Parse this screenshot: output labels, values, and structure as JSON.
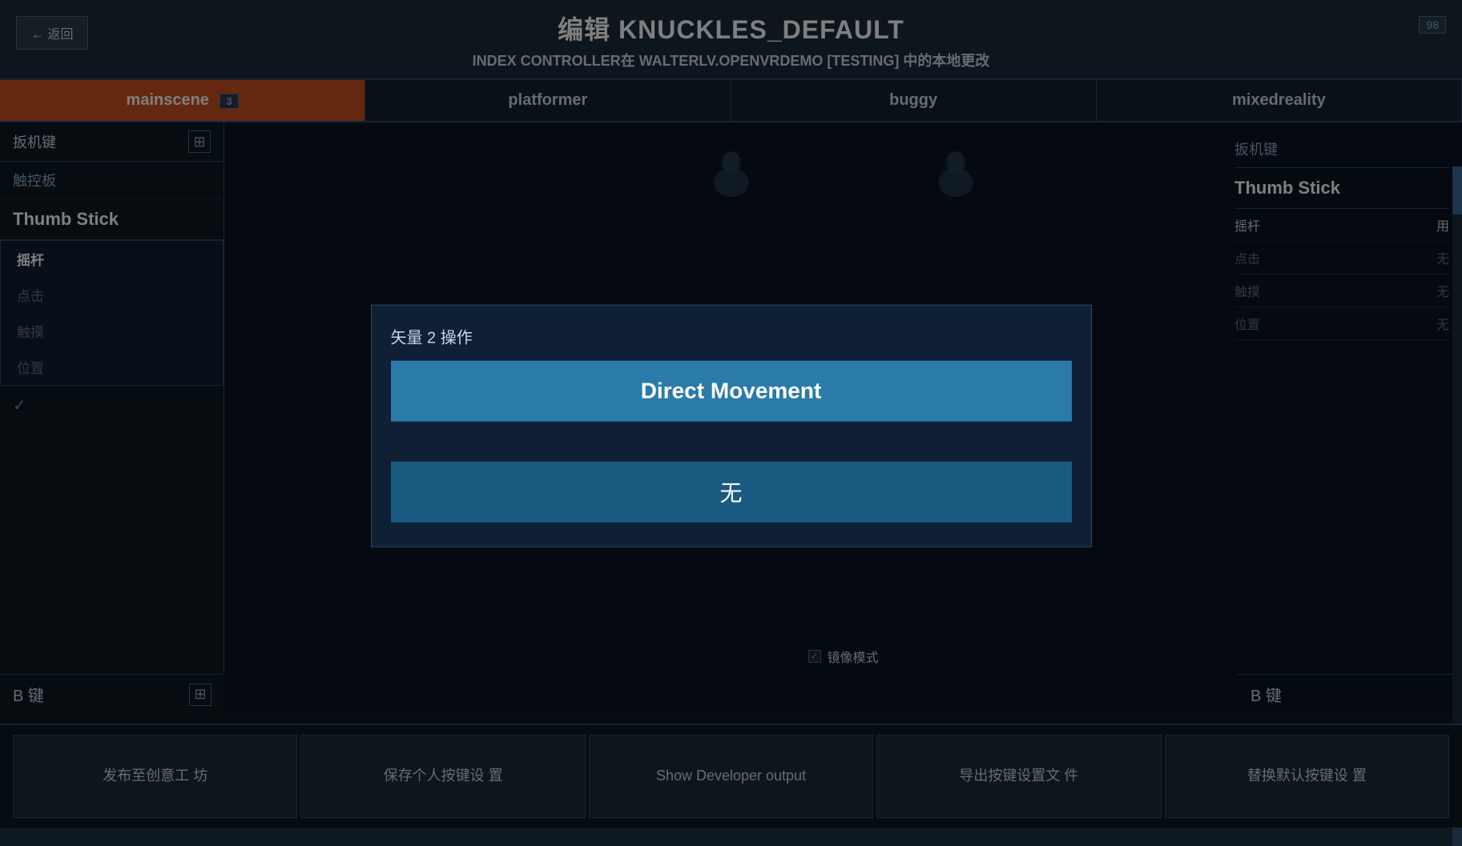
{
  "header": {
    "title": "编辑 KNUCKLES_DEFAULT",
    "subtitle": "INDEX CONTROLLER在 WALTERLV.OPENVRDEMO [TESTING] 中的本地更改",
    "back_label": "← 返回",
    "counter": "98"
  },
  "tabs": [
    {
      "id": "mainscene",
      "label": "mainscene",
      "active": true,
      "badge": "3"
    },
    {
      "id": "platformer",
      "label": "platformer",
      "active": false,
      "badge": ""
    },
    {
      "id": "buggy",
      "label": "buggy",
      "active": false,
      "badge": ""
    },
    {
      "id": "mixedreality",
      "label": "mixedreality",
      "active": false,
      "badge": ""
    }
  ],
  "left": {
    "trigger_label": "扳机键",
    "touchpad_label": "触控板",
    "thumb_stick_label": "Thumb Stick",
    "sub_items": [
      {
        "label": "摇杆",
        "active": true
      },
      {
        "label": "点击",
        "active": false
      },
      {
        "label": "触摸",
        "active": false
      },
      {
        "label": "位置",
        "active": false
      }
    ],
    "check_label": "✓",
    "b_key_label": "B 键"
  },
  "right": {
    "trigger_label": "扳机键",
    "thumb_stick_label": "tick",
    "items": [
      {
        "label": "摇杆",
        "value": "用"
      },
      {
        "label": "点击",
        "value": "无"
      },
      {
        "label": "触摸",
        "value": "无"
      },
      {
        "label": "位置",
        "value": "无"
      }
    ],
    "b_key_label": "B 键",
    "mirror_label": "镜像模式"
  },
  "modal": {
    "title": "矢量 2 操作",
    "option_primary": "Direct Movement",
    "option_secondary": "无"
  },
  "toolbar": {
    "btn1": "发布至创意工\n坊",
    "btn2": "保存个人按键设\n置",
    "btn3": "Show Developer\noutput",
    "btn4": "导出按键设置文\n件",
    "btn5": "替换默认按键设\n置"
  }
}
